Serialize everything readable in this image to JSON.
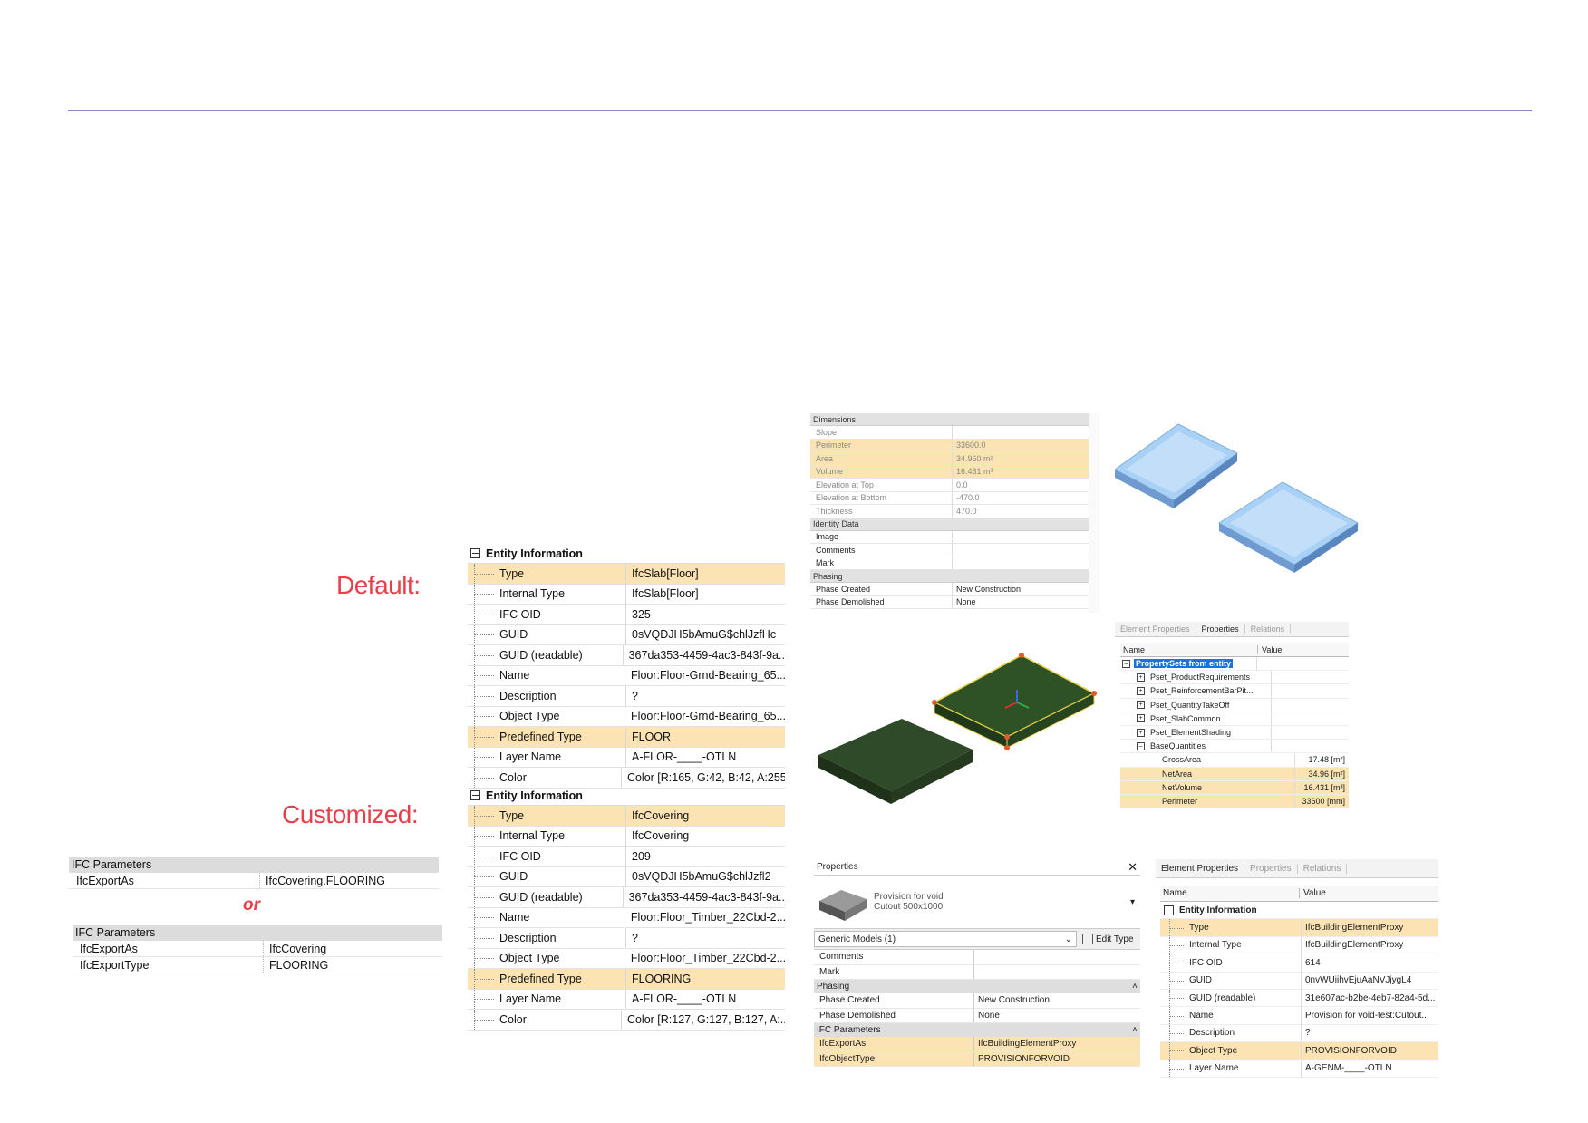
{
  "labels": {
    "default": "Default:",
    "customized": "Customized:",
    "or": "or"
  },
  "ifc_params_a": {
    "header": "IFC Parameters",
    "rows": [
      {
        "name": "IfcExportAs",
        "value": "IfcCovering.FLOORING"
      }
    ]
  },
  "ifc_params_b": {
    "header": "IFC Parameters",
    "rows": [
      {
        "name": "IfcExportAs",
        "value": "IfcCovering"
      },
      {
        "name": "IfcExportType",
        "value": "FLOORING"
      }
    ]
  },
  "entity_default": {
    "header": "Entity Information",
    "rows": [
      {
        "name": "Type",
        "value": "IfcSlab[Floor]"
      },
      {
        "name": "Internal Type",
        "value": "IfcSlab[Floor]"
      },
      {
        "name": "IFC OID",
        "value": "325"
      },
      {
        "name": "GUID",
        "value": "0sVQDJH5bAmuG$chlJzfHc"
      },
      {
        "name": "GUID (readable)",
        "value": "367da353-4459-4ac3-843f-9a..."
      },
      {
        "name": "Name",
        "value": "Floor:Floor-Grnd-Bearing_65..."
      },
      {
        "name": "Description",
        "value": "?"
      },
      {
        "name": "Object Type",
        "value": "Floor:Floor-Grnd-Bearing_65..."
      },
      {
        "name": "Predefined Type",
        "value": "FLOOR"
      },
      {
        "name": "Layer Name",
        "value": "A-FLOR-____-OTLN"
      },
      {
        "name": "Color",
        "value": "Color [R:165, G:42, B:42, A:255]"
      }
    ]
  },
  "entity_custom": {
    "header": "Entity Information",
    "rows": [
      {
        "name": "Type",
        "value": "IfcCovering"
      },
      {
        "name": "Internal Type",
        "value": "IfcCovering"
      },
      {
        "name": "IFC OID",
        "value": "209"
      },
      {
        "name": "GUID",
        "value": "0sVQDJH5bAmuG$chlJzfl2"
      },
      {
        "name": "GUID (readable)",
        "value": "367da353-4459-4ac3-843f-9a..."
      },
      {
        "name": "Name",
        "value": "Floor:Floor_Timber_22Cbd-2..."
      },
      {
        "name": "Description",
        "value": "?"
      },
      {
        "name": "Object Type",
        "value": "Floor:Floor_Timber_22Cbd-2..."
      },
      {
        "name": "Predefined Type",
        "value": "FLOORING"
      },
      {
        "name": "Layer Name",
        "value": "A-FLOR-____-OTLN"
      },
      {
        "name": "Color",
        "value": "Color [R:127, G:127, B:127, A:..."
      }
    ]
  },
  "revit_dims": {
    "sections": [
      {
        "title": "Dimensions",
        "rows": [
          {
            "name": "Slope",
            "value": ""
          },
          {
            "name": "Perimeter",
            "value": "33600.0"
          },
          {
            "name": "Area",
            "value": "34.960 m²"
          },
          {
            "name": "Volume",
            "value": "16.431 m³"
          },
          {
            "name": "Elevation at Top",
            "value": "0.0"
          },
          {
            "name": "Elevation at Bottom",
            "value": "-470.0"
          },
          {
            "name": "Thickness",
            "value": "470.0"
          }
        ]
      },
      {
        "title": "Identity Data",
        "rows": [
          {
            "name": "Image",
            "value": ""
          },
          {
            "name": "Comments",
            "value": ""
          },
          {
            "name": "Mark",
            "value": ""
          }
        ]
      },
      {
        "title": "Phasing",
        "rows": [
          {
            "name": "Phase Created",
            "value": "New Construction"
          },
          {
            "name": "Phase Demolished",
            "value": "None"
          }
        ]
      }
    ]
  },
  "pset_panel": {
    "tabs": [
      "Element Properties",
      "Properties",
      "Relations"
    ],
    "col_name": "Name",
    "col_value": "Value",
    "root": "PropertySets from entity",
    "groups": [
      "Pset_ProductRequirements",
      "Pset_ReinforcementBarPit...",
      "Pset_QuantityTakeOff",
      "Pset_SlabCommon",
      "Pset_ElementShading",
      "BaseQuantities"
    ],
    "quantities": [
      {
        "name": "GrossArea",
        "value": "17.48 [m²]"
      },
      {
        "name": "NetArea",
        "value": "34.96 [m²]"
      },
      {
        "name": "NetVolume",
        "value": "16.431 [m³]"
      },
      {
        "name": "Perimeter",
        "value": "33600 [mm]"
      }
    ]
  },
  "revit_props": {
    "title": "Properties",
    "close": "✕",
    "type_name": "Provision for void",
    "type_sub": "Cutout 500x1000",
    "selector": "Generic Models (1)",
    "edit_type": "Edit Type",
    "rows_a": [
      {
        "name": "Comments",
        "value": ""
      },
      {
        "name": "Mark",
        "value": ""
      }
    ],
    "phasing_title": "Phasing",
    "rows_b": [
      {
        "name": "Phase Created",
        "value": "New Construction"
      },
      {
        "name": "Phase Demolished",
        "value": "None"
      }
    ],
    "ifc_title": "IFC Parameters",
    "rows_c": [
      {
        "name": "IfcExportAs",
        "value": "IfcBuildingElementProxy"
      },
      {
        "name": "IfcObjectType",
        "value": "PROVISIONFORVOID"
      }
    ]
  },
  "entity_proxy": {
    "tabs": [
      "Element Properties",
      "Properties",
      "Relations"
    ],
    "col_name": "Name",
    "col_value": "Value",
    "header": "Entity Information",
    "rows": [
      {
        "name": "Type",
        "value": "IfcBuildingElementProxy"
      },
      {
        "name": "Internal Type",
        "value": "IfcBuildingElementProxy"
      },
      {
        "name": "IFC OID",
        "value": "614"
      },
      {
        "name": "GUID",
        "value": "0nvWUiihvEjuAaNVJjygL4"
      },
      {
        "name": "GUID (readable)",
        "value": "31e607ac-b2be-4eb7-82a4-5d..."
      },
      {
        "name": "Name",
        "value": "Provision for void-test:Cutout..."
      },
      {
        "name": "Description",
        "value": "?"
      },
      {
        "name": "Object Type",
        "value": "PROVISIONFORVOID"
      },
      {
        "name": "Layer Name",
        "value": "A-GENM-____-OTLN"
      }
    ]
  }
}
